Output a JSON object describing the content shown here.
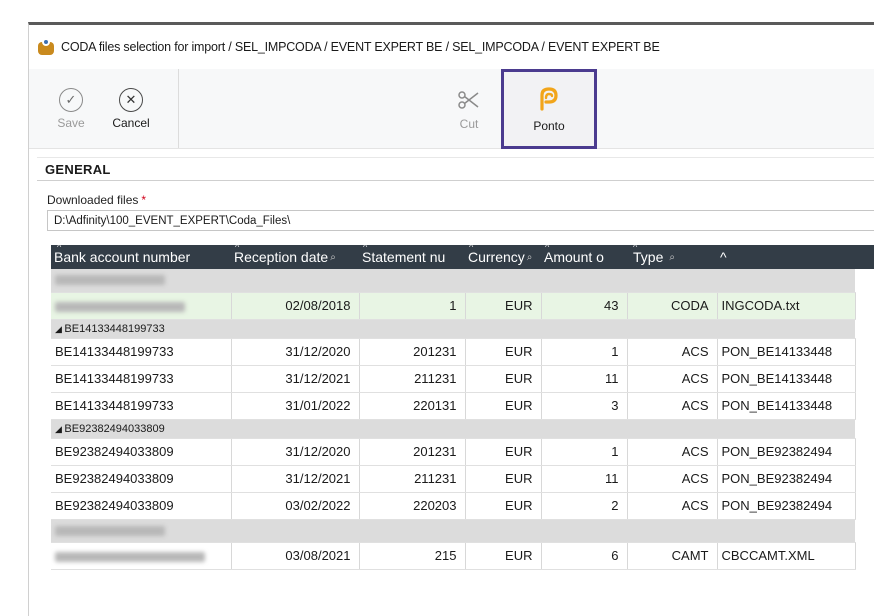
{
  "window": {
    "title": "CODA files selection for import / SEL_IMPCODA / EVENT EXPERT BE / SEL_IMPCODA / EVENT EXPERT BE"
  },
  "toolbar": {
    "save_label": "Save",
    "cancel_label": "Cancel",
    "cut_label": "Cut",
    "ponto_label": "Ponto"
  },
  "general": {
    "section_title": "GENERAL",
    "downloaded_files_label": "Downloaded files",
    "required_marker": "*",
    "downloaded_files_value": "D:\\Adfinity\\100_EVENT_EXPERT\\Coda_Files\\"
  },
  "grid": {
    "columns": [
      "Bank account number",
      "Reception date",
      "Statement nu",
      "Currency",
      "Amount o",
      "Type",
      ""
    ],
    "groups": [
      {
        "label": "",
        "redacted": true,
        "rows": [
          {
            "account": "",
            "date": "02/08/2018",
            "statement": "1",
            "currency": "EUR",
            "amount": "43",
            "type": "CODA",
            "file": "INGCODA.txt",
            "selected": true
          }
        ]
      },
      {
        "label": "BE14133448199733",
        "redacted": false,
        "rows": [
          {
            "account": "BE14133448199733",
            "date": "31/12/2020",
            "statement": "201231",
            "currency": "EUR",
            "amount": "1",
            "type": "ACS",
            "file": "PON_BE14133448"
          },
          {
            "account": "BE14133448199733",
            "date": "31/12/2021",
            "statement": "211231",
            "currency": "EUR",
            "amount": "11",
            "type": "ACS",
            "file": "PON_BE14133448"
          },
          {
            "account": "BE14133448199733",
            "date": "31/01/2022",
            "statement": "220131",
            "currency": "EUR",
            "amount": "3",
            "type": "ACS",
            "file": "PON_BE14133448"
          }
        ]
      },
      {
        "label": "BE92382494033809",
        "redacted": false,
        "rows": [
          {
            "account": "BE92382494033809",
            "date": "31/12/2020",
            "statement": "201231",
            "currency": "EUR",
            "amount": "1",
            "type": "ACS",
            "file": "PON_BE92382494"
          },
          {
            "account": "BE92382494033809",
            "date": "31/12/2021",
            "statement": "211231",
            "currency": "EUR",
            "amount": "11",
            "type": "ACS",
            "file": "PON_BE92382494"
          },
          {
            "account": "BE92382494033809",
            "date": "03/02/2022",
            "statement": "220203",
            "currency": "EUR",
            "amount": "2",
            "type": "ACS",
            "file": "PON_BE92382494"
          }
        ]
      },
      {
        "label": "",
        "redacted": true,
        "rows": [
          {
            "account": "",
            "date": "03/08/2021",
            "statement": "215",
            "currency": "EUR",
            "amount": "6",
            "type": "CAMT",
            "file": "CBCCAMT.XML"
          }
        ]
      }
    ]
  },
  "colors": {
    "header_bg": "#333d47",
    "highlight_border": "#4b3b8f",
    "selected_row": "#e8f5e4",
    "group_row": "#dcdcdc",
    "required": "#d0021b"
  },
  "icons": {
    "save": "check-circle-icon",
    "cancel": "x-circle-icon",
    "cut": "scissors-icon",
    "ponto": "ponto-logo-icon",
    "app": "app-icon"
  }
}
